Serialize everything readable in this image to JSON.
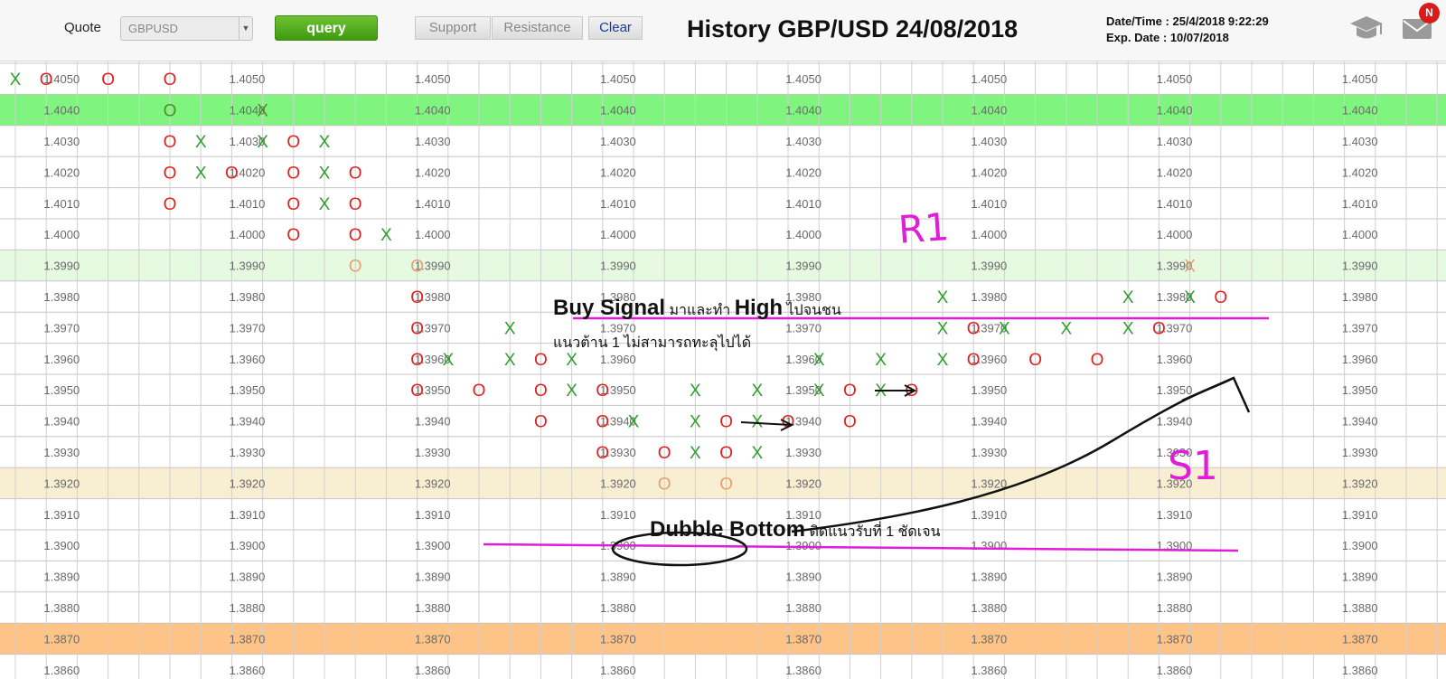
{
  "toolbar": {
    "quote_label": "Quote",
    "quote_value": "GBPUSD",
    "query_label": "query",
    "support_label": "Support",
    "resistance_label": "Resistance",
    "clear_label": "Clear",
    "title": "History GBP/USD 24/08/2018",
    "datetime_label": "Date/Time :",
    "datetime_value": "25/4/2018 9:22:29",
    "expdate_label": "Exp. Date :",
    "expdate_value": "10/07/2018",
    "notif_count": "N",
    "icons": [
      "graduation-cap-icon",
      "mail-icon",
      "chevron-down-icon"
    ]
  },
  "colors": {
    "x_mark": "#2e9e2e",
    "o_mark": "#e02020",
    "band_green_strong": "#7ff57f",
    "band_green_light": "#e6f9e1",
    "band_beige": "#f8efd2",
    "band_orange": "#fec386",
    "annotation_magenta": "#e01ed8",
    "annotation_ink": "#111111"
  },
  "chart_data": {
    "type": "point-and-figure",
    "prices": [
      "1.4050",
      "1.4040",
      "1.4030",
      "1.4020",
      "1.4010",
      "1.4000",
      "1.3990",
      "1.3980",
      "1.3970",
      "1.3960",
      "1.3950",
      "1.3940",
      "1.3930",
      "1.3920",
      "1.3910",
      "1.3900",
      "1.3890",
      "1.3880",
      "1.3870",
      "1.3860"
    ],
    "highlight_bands": [
      {
        "price": "1.4040",
        "style": "green_strong"
      },
      {
        "price": "1.3990",
        "style": "green_light"
      },
      {
        "price": "1.3920",
        "style": "beige"
      },
      {
        "price": "1.3870",
        "style": "orange"
      }
    ],
    "columns": [
      {
        "type": "X",
        "prices": [
          "1.4050"
        ]
      },
      {
        "type": "O",
        "prices": [
          "1.4050"
        ]
      },
      {
        "type": "X",
        "prices": []
      },
      {
        "type": "O",
        "prices": [
          "1.4050"
        ]
      },
      {
        "type": "X",
        "prices": []
      },
      {
        "type": "O",
        "prices": [
          "1.4050",
          "1.4040",
          "1.4030",
          "1.4020",
          "1.4010"
        ]
      },
      {
        "type": "X",
        "prices": [
          "1.4030",
          "1.4020"
        ]
      },
      {
        "type": "O",
        "prices": [
          "1.4020"
        ]
      },
      {
        "type": "X",
        "prices": [
          "1.4040",
          "1.4030"
        ]
      },
      {
        "type": "O",
        "prices": [
          "1.4030",
          "1.4020",
          "1.4010",
          "1.4000"
        ]
      },
      {
        "type": "X",
        "prices": [
          "1.4030",
          "1.4020",
          "1.4010"
        ]
      },
      {
        "type": "O",
        "prices": [
          "1.4020",
          "1.4010",
          "1.4000",
          "1.3990"
        ]
      },
      {
        "type": "X",
        "prices": [
          "1.4000"
        ]
      },
      {
        "type": "O",
        "prices": [
          "1.3990",
          "1.3980",
          "1.3970",
          "1.3960",
          "1.3950"
        ]
      },
      {
        "type": "X",
        "prices": [
          "1.3960"
        ]
      },
      {
        "type": "O",
        "prices": [
          "1.3950"
        ]
      },
      {
        "type": "X",
        "prices": [
          "1.3970",
          "1.3960"
        ]
      },
      {
        "type": "O",
        "prices": [
          "1.3960",
          "1.3950",
          "1.3940"
        ]
      },
      {
        "type": "X",
        "prices": [
          "1.3960",
          "1.3950"
        ]
      },
      {
        "type": "O",
        "prices": [
          "1.3950",
          "1.3940",
          "1.3930"
        ]
      },
      {
        "type": "X",
        "prices": [
          "1.3940"
        ]
      },
      {
        "type": "O",
        "prices": [
          "1.3930",
          "1.3920"
        ]
      },
      {
        "type": "X",
        "prices": [
          "1.3950",
          "1.3940",
          "1.3930"
        ]
      },
      {
        "type": "O",
        "prices": [
          "1.3940",
          "1.3930",
          "1.3920"
        ]
      },
      {
        "type": "X",
        "prices": [
          "1.3950",
          "1.3940",
          "1.3930"
        ]
      },
      {
        "type": "O",
        "prices": [
          "1.3940"
        ]
      },
      {
        "type": "X",
        "prices": [
          "1.3960",
          "1.3950"
        ]
      },
      {
        "type": "O",
        "prices": [
          "1.3950",
          "1.3940"
        ]
      },
      {
        "type": "X",
        "prices": [
          "1.3960",
          "1.3950"
        ]
      },
      {
        "type": "O",
        "prices": [
          "1.3950"
        ]
      },
      {
        "type": "X",
        "prices": [
          "1.3980",
          "1.3970",
          "1.3960"
        ]
      },
      {
        "type": "O",
        "prices": [
          "1.3970",
          "1.3960"
        ]
      },
      {
        "type": "X",
        "prices": [
          "1.3970"
        ]
      },
      {
        "type": "O",
        "prices": [
          "1.3960"
        ]
      },
      {
        "type": "X",
        "prices": [
          "1.3970"
        ]
      },
      {
        "type": "O",
        "prices": [
          "1.3960"
        ]
      },
      {
        "type": "X",
        "prices": [
          "1.3980",
          "1.3970"
        ]
      },
      {
        "type": "O",
        "prices": [
          "1.3970"
        ]
      },
      {
        "type": "X",
        "prices": [
          "1.3990",
          "1.3980"
        ]
      },
      {
        "type": "O",
        "prices": [
          "1.3980"
        ]
      }
    ],
    "annotations": {
      "r1_label": "R1",
      "s1_label": "S1",
      "buy_signal_bold": "Buy Signal",
      "buy_signal_text1": "มาและทำ",
      "buy_signal_high": "High",
      "buy_signal_text2": "ไปจนชน",
      "buy_signal_line2": "แนวต้าน 1 ไม่สามารถทะลุไปได้",
      "double_bottom_bold": "Dubble Bottom",
      "double_bottom_text": "ติดแนวรับที่ 1 ชัดเจน"
    }
  }
}
